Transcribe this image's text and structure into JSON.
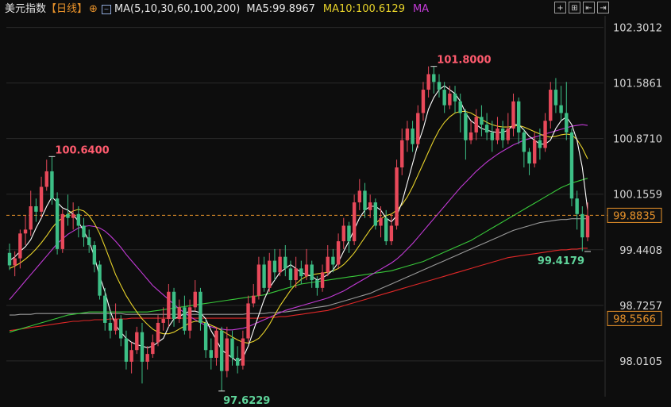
{
  "header": {
    "index_name": "美元指数",
    "period": "【日线】",
    "indicator": "MA(5,10,30,60,100,200)",
    "ma5": "MA5:99.8967",
    "ma10": "MA10:100.6129",
    "ma_more": "MA"
  },
  "toolbar": {
    "buttons": [
      "+",
      "⊞",
      "⇤",
      "⇥"
    ]
  },
  "colors": {
    "up": "#e8495a",
    "down": "#3dbf86",
    "ma5": "#ffffff",
    "ma10": "#e8d32a",
    "ma30": "#c23ad6",
    "ma60": "#38c93a",
    "ma100": "#9a9a9a",
    "ma200": "#e02828",
    "grid": "#2a2a2a",
    "dash": "#e8922a",
    "high_label": "#ff5b6e",
    "low_label": "#5fd59b"
  },
  "chart_data": {
    "type": "candlestick",
    "title": "美元指数【日线】",
    "ylim": [
      97.55,
      102.45
    ],
    "y_ticks": [
      "102.3012",
      "101.5861",
      "100.8710",
      "100.1559",
      "99.4408",
      "98.7257",
      "98.0105"
    ],
    "last_price": "99.8835",
    "last_ma200": "98.5566",
    "annotations": [
      {
        "text": "101.8000",
        "value": 101.8,
        "color": "up"
      },
      {
        "text": "100.6400",
        "value": 100.64,
        "color": "up"
      },
      {
        "text": "99.4179",
        "value": 99.4179,
        "color": "down"
      },
      {
        "text": "97.6229",
        "value": 97.6229,
        "color": "down"
      }
    ],
    "candles": [
      [
        99.4,
        99.24,
        99.52,
        99.18
      ],
      [
        99.24,
        99.33,
        99.42,
        99.1
      ],
      [
        99.33,
        99.65,
        99.7,
        99.2
      ],
      [
        99.65,
        99.7,
        99.88,
        99.5
      ],
      [
        99.7,
        100.0,
        100.2,
        99.62
      ],
      [
        100.0,
        99.93,
        100.1,
        99.8
      ],
      [
        99.93,
        100.25,
        100.38,
        99.85
      ],
      [
        100.25,
        100.45,
        100.6,
        100.2
      ],
      [
        100.45,
        100.1,
        100.64,
        100.02
      ],
      [
        100.1,
        99.45,
        100.18,
        99.38
      ],
      [
        99.45,
        99.9,
        99.96,
        99.4
      ],
      [
        99.9,
        99.85,
        100.15,
        99.75
      ],
      [
        99.85,
        99.9,
        100.05,
        99.7
      ],
      [
        99.9,
        99.75,
        100.0,
        99.6
      ],
      [
        99.75,
        99.6,
        99.85,
        99.48
      ],
      [
        99.6,
        99.5,
        99.7,
        99.4
      ],
      [
        99.5,
        99.25,
        99.55,
        99.15
      ],
      [
        99.25,
        98.85,
        99.3,
        98.8
      ],
      [
        98.85,
        98.5,
        98.95,
        98.4
      ],
      [
        98.5,
        98.4,
        98.65,
        98.3
      ],
      [
        98.4,
        98.55,
        98.75,
        98.35
      ],
      [
        98.55,
        98.3,
        98.6,
        98.2
      ],
      [
        98.3,
        98.0,
        98.4,
        97.9
      ],
      [
        98.0,
        98.15,
        98.25,
        97.85
      ],
      [
        98.15,
        98.38,
        98.45,
        98.1
      ],
      [
        98.38,
        98.0,
        98.5,
        97.72
      ],
      [
        98.0,
        98.1,
        98.2,
        97.9
      ],
      [
        98.1,
        98.25,
        98.35,
        98.05
      ],
      [
        98.25,
        98.5,
        98.6,
        98.2
      ],
      [
        98.5,
        98.55,
        98.7,
        98.4
      ],
      [
        98.55,
        98.9,
        99.0,
        98.45
      ],
      [
        98.9,
        98.55,
        98.95,
        98.45
      ],
      [
        98.55,
        98.7,
        98.8,
        98.5
      ],
      [
        98.7,
        98.4,
        98.85,
        98.35
      ],
      [
        98.4,
        98.7,
        98.8,
        98.3
      ],
      [
        98.7,
        98.9,
        99.05,
        98.65
      ],
      [
        98.9,
        98.5,
        98.95,
        98.4
      ],
      [
        98.5,
        98.15,
        98.55,
        98.05
      ],
      [
        98.15,
        98.05,
        98.3,
        97.9
      ],
      [
        98.05,
        98.4,
        98.45,
        97.95
      ],
      [
        98.4,
        97.88,
        98.45,
        97.62
      ],
      [
        97.88,
        98.3,
        98.45,
        97.8
      ],
      [
        98.3,
        98.05,
        98.4,
        97.95
      ],
      [
        98.05,
        97.95,
        98.2,
        97.85
      ],
      [
        97.95,
        98.3,
        98.4,
        97.9
      ],
      [
        98.3,
        98.75,
        98.85,
        98.25
      ],
      [
        98.75,
        98.85,
        99.0,
        98.7
      ],
      [
        98.85,
        99.25,
        99.35,
        98.8
      ],
      [
        99.25,
        98.95,
        99.35,
        98.9
      ],
      [
        98.95,
        99.3,
        99.4,
        98.9
      ],
      [
        99.3,
        99.15,
        99.45,
        99.05
      ],
      [
        99.15,
        99.35,
        99.45,
        99.1
      ],
      [
        99.35,
        99.2,
        99.5,
        99.1
      ],
      [
        99.2,
        99.05,
        99.3,
        98.95
      ],
      [
        99.05,
        99.2,
        99.35,
        98.95
      ],
      [
        99.2,
        99.1,
        99.3,
        99.0
      ],
      [
        99.1,
        99.25,
        99.45,
        99.05
      ],
      [
        99.25,
        99.05,
        99.3,
        98.95
      ],
      [
        99.05,
        98.95,
        99.1,
        98.85
      ],
      [
        98.95,
        99.15,
        99.25,
        98.9
      ],
      [
        99.15,
        99.35,
        99.5,
        99.1
      ],
      [
        99.35,
        99.25,
        99.45,
        99.15
      ],
      [
        99.25,
        99.55,
        99.65,
        99.2
      ],
      [
        99.55,
        99.75,
        99.85,
        99.45
      ],
      [
        99.75,
        99.55,
        99.8,
        99.4
      ],
      [
        99.55,
        100.05,
        100.15,
        99.5
      ],
      [
        100.05,
        100.2,
        100.35,
        99.95
      ],
      [
        100.2,
        99.95,
        100.3,
        99.85
      ],
      [
        99.95,
        100.05,
        100.15,
        99.85
      ],
      [
        100.05,
        99.75,
        100.1,
        99.7
      ],
      [
        99.75,
        99.85,
        100.0,
        99.6
      ],
      [
        99.85,
        99.55,
        99.95,
        99.5
      ],
      [
        99.55,
        99.75,
        99.9,
        99.5
      ],
      [
        99.75,
        100.5,
        100.6,
        99.7
      ],
      [
        100.5,
        100.85,
        101.0,
        100.4
      ],
      [
        100.85,
        101.0,
        101.1,
        100.7
      ],
      [
        101.0,
        100.8,
        101.1,
        100.7
      ],
      [
        100.8,
        101.2,
        101.3,
        100.75
      ],
      [
        101.2,
        101.5,
        101.6,
        101.1
      ],
      [
        101.5,
        101.7,
        101.8,
        101.4
      ],
      [
        101.7,
        101.6,
        101.8,
        101.45
      ],
      [
        101.6,
        101.5,
        101.7,
        101.4
      ],
      [
        101.5,
        101.3,
        101.6,
        101.2
      ],
      [
        101.3,
        101.45,
        101.55,
        101.25
      ],
      [
        101.45,
        101.35,
        101.55,
        101.2
      ],
      [
        101.35,
        101.2,
        101.45,
        100.95
      ],
      [
        101.2,
        100.85,
        101.25,
        100.6
      ],
      [
        100.85,
        100.95,
        101.1,
        100.8
      ],
      [
        100.95,
        101.15,
        101.25,
        100.85
      ],
      [
        101.15,
        101.05,
        101.3,
        100.9
      ],
      [
        101.05,
        100.95,
        101.2,
        100.85
      ],
      [
        100.95,
        100.85,
        101.1,
        100.7
      ],
      [
        100.85,
        101.0,
        101.15,
        100.8
      ],
      [
        101.0,
        100.85,
        101.1,
        100.75
      ],
      [
        100.85,
        101.0,
        101.2,
        100.8
      ],
      [
        101.0,
        101.35,
        101.45,
        100.9
      ],
      [
        101.35,
        100.95,
        101.4,
        100.8
      ],
      [
        100.95,
        100.7,
        101.0,
        100.5
      ],
      [
        100.7,
        100.55,
        100.75,
        100.4
      ],
      [
        100.55,
        100.85,
        100.95,
        100.5
      ],
      [
        100.85,
        100.75,
        101.0,
        100.6
      ],
      [
        100.75,
        101.1,
        101.2,
        100.7
      ],
      [
        101.1,
        101.5,
        101.6,
        101.0
      ],
      [
        101.5,
        101.3,
        101.65,
        101.2
      ],
      [
        101.3,
        101.2,
        101.55,
        101.1
      ],
      [
        101.2,
        100.95,
        101.6,
        100.85
      ],
      [
        100.95,
        100.1,
        101.0,
        100.0
      ],
      [
        100.1,
        99.9,
        100.2,
        99.7
      ],
      [
        99.9,
        99.6,
        100.0,
        99.42
      ],
      [
        99.6,
        99.88,
        100.05,
        99.55
      ]
    ],
    "ma5": [
      99.3,
      99.35,
      99.42,
      99.48,
      99.57,
      99.72,
      99.85,
      100.0,
      100.12,
      100.05,
      99.98,
      99.95,
      99.9,
      99.8,
      99.68,
      99.55,
      99.35,
      99.1,
      98.9,
      98.65,
      98.47,
      98.38,
      98.3,
      98.25,
      98.22,
      98.2,
      98.18,
      98.2,
      98.25,
      98.3,
      98.45,
      98.55,
      98.58,
      98.62,
      98.65,
      98.65,
      98.63,
      98.55,
      98.4,
      98.28,
      98.15,
      98.1,
      98.05,
      98.0,
      98.05,
      98.2,
      98.4,
      98.6,
      98.8,
      98.95,
      99.05,
      99.15,
      99.2,
      99.25,
      99.2,
      99.15,
      99.12,
      99.1,
      99.05,
      99.08,
      99.12,
      99.18,
      99.28,
      99.42,
      99.55,
      99.7,
      99.85,
      99.95,
      100.0,
      100.0,
      99.95,
      99.85,
      99.8,
      99.88,
      100.05,
      100.3,
      100.55,
      100.8,
      101.0,
      101.25,
      101.4,
      101.5,
      101.55,
      101.5,
      101.45,
      101.35,
      101.2,
      101.1,
      101.05,
      101.0,
      100.98,
      100.96,
      100.95,
      100.95,
      100.98,
      101.05,
      101.05,
      100.98,
      100.9,
      100.85,
      100.8,
      100.8,
      100.85,
      101.0,
      101.1,
      101.15,
      101.05,
      100.85,
      100.5,
      99.95
    ],
    "ma10": [
      99.2,
      99.23,
      99.27,
      99.32,
      99.38,
      99.45,
      99.53,
      99.62,
      99.72,
      99.8,
      99.85,
      99.9,
      99.94,
      99.96,
      99.94,
      99.88,
      99.78,
      99.65,
      99.48,
      99.3,
      99.12,
      98.98,
      98.85,
      98.74,
      98.64,
      98.55,
      98.48,
      98.42,
      98.38,
      98.36,
      98.36,
      98.38,
      98.42,
      98.46,
      98.5,
      98.52,
      98.52,
      98.5,
      98.47,
      98.44,
      98.4,
      98.36,
      98.32,
      98.28,
      98.25,
      98.24,
      98.26,
      98.3,
      98.38,
      98.48,
      98.6,
      98.72,
      98.82,
      98.92,
      99.0,
      99.06,
      99.1,
      99.12,
      99.13,
      99.14,
      99.15,
      99.17,
      99.2,
      99.25,
      99.32,
      99.4,
      99.5,
      99.6,
      99.7,
      99.78,
      99.84,
      99.88,
      99.9,
      99.95,
      100.02,
      100.12,
      100.25,
      100.4,
      100.55,
      100.7,
      100.85,
      100.98,
      101.08,
      101.15,
      101.2,
      101.22,
      101.22,
      101.2,
      101.16,
      101.12,
      101.08,
      101.05,
      101.03,
      101.02,
      101.02,
      101.03,
      101.04,
      101.02,
      100.99,
      100.96,
      100.93,
      100.9,
      100.89,
      100.9,
      100.92,
      100.93,
      100.92,
      100.86,
      100.75,
      100.61
    ],
    "ma30": [
      98.8,
      98.88,
      98.96,
      99.04,
      99.12,
      99.2,
      99.28,
      99.36,
      99.44,
      99.52,
      99.58,
      99.64,
      99.68,
      99.72,
      99.74,
      99.75,
      99.74,
      99.72,
      99.68,
      99.62,
      99.55,
      99.47,
      99.38,
      99.3,
      99.22,
      99.14,
      99.06,
      98.98,
      98.92,
      98.86,
      98.8,
      98.74,
      98.68,
      98.63,
      98.58,
      98.54,
      98.5,
      98.47,
      98.45,
      98.43,
      98.42,
      98.41,
      98.41,
      98.42,
      98.43,
      98.45,
      98.48,
      98.51,
      98.54,
      98.57,
      98.6,
      98.63,
      98.66,
      98.68,
      98.7,
      98.72,
      98.74,
      98.76,
      98.78,
      98.8,
      98.82,
      98.85,
      98.88,
      98.91,
      98.95,
      98.99,
      99.03,
      99.07,
      99.11,
      99.15,
      99.19,
      99.23,
      99.27,
      99.32,
      99.38,
      99.45,
      99.52,
      99.6,
      99.68,
      99.76,
      99.84,
      99.92,
      100.0,
      100.08,
      100.16,
      100.24,
      100.31,
      100.38,
      100.45,
      100.51,
      100.57,
      100.62,
      100.67,
      100.71,
      100.75,
      100.79,
      100.82,
      100.85,
      100.87,
      100.89,
      100.91,
      100.93,
      100.95,
      100.97,
      100.99,
      101.01,
      101.03,
      101.04,
      101.05,
      101.04
    ],
    "ma60": [
      98.38,
      98.4,
      98.42,
      98.44,
      98.46,
      98.48,
      98.5,
      98.52,
      98.54,
      98.56,
      98.58,
      98.6,
      98.61,
      98.62,
      98.63,
      98.64,
      98.64,
      98.64,
      98.64,
      98.64,
      98.64,
      98.64,
      98.64,
      98.64,
      98.64,
      98.64,
      98.64,
      98.65,
      98.66,
      98.67,
      98.68,
      98.69,
      98.7,
      98.71,
      98.72,
      98.73,
      98.74,
      98.75,
      98.76,
      98.77,
      98.78,
      98.79,
      98.8,
      98.81,
      98.82,
      98.83,
      98.84,
      98.85,
      98.86,
      98.88,
      98.9,
      98.92,
      98.94,
      98.96,
      98.98,
      99.0,
      99.01,
      99.02,
      99.03,
      99.04,
      99.05,
      99.06,
      99.07,
      99.08,
      99.09,
      99.1,
      99.11,
      99.12,
      99.13,
      99.14,
      99.15,
      99.16,
      99.17,
      99.19,
      99.21,
      99.23,
      99.25,
      99.27,
      99.29,
      99.32,
      99.35,
      99.38,
      99.41,
      99.44,
      99.47,
      99.5,
      99.53,
      99.56,
      99.6,
      99.64,
      99.68,
      99.72,
      99.76,
      99.8,
      99.84,
      99.88,
      99.92,
      99.96,
      100.0,
      100.04,
      100.08,
      100.12,
      100.16,
      100.2,
      100.24,
      100.27,
      100.3,
      100.32,
      100.34,
      100.36
    ],
    "ma100": [
      98.6,
      98.6,
      98.61,
      98.61,
      98.61,
      98.62,
      98.62,
      98.62,
      98.62,
      98.62,
      98.62,
      98.62,
      98.62,
      98.62,
      98.62,
      98.62,
      98.62,
      98.62,
      98.62,
      98.62,
      98.62,
      98.62,
      98.61,
      98.61,
      98.61,
      98.61,
      98.61,
      98.61,
      98.61,
      98.61,
      98.61,
      98.61,
      98.61,
      98.61,
      98.61,
      98.61,
      98.61,
      98.61,
      98.61,
      98.61,
      98.61,
      98.61,
      98.61,
      98.61,
      98.61,
      98.62,
      98.62,
      98.62,
      98.62,
      98.63,
      98.63,
      98.64,
      98.64,
      98.65,
      98.66,
      98.67,
      98.68,
      98.69,
      98.7,
      98.71,
      98.72,
      98.74,
      98.76,
      98.78,
      98.8,
      98.82,
      98.84,
      98.86,
      98.88,
      98.91,
      98.94,
      98.97,
      99.0,
      99.03,
      99.06,
      99.09,
      99.12,
      99.15,
      99.18,
      99.21,
      99.24,
      99.27,
      99.3,
      99.33,
      99.36,
      99.39,
      99.42,
      99.45,
      99.48,
      99.51,
      99.54,
      99.57,
      99.6,
      99.63,
      99.66,
      99.69,
      99.71,
      99.73,
      99.75,
      99.77,
      99.79,
      99.8,
      99.81,
      99.82,
      99.83,
      99.83,
      99.84,
      99.84,
      99.84,
      99.84
    ],
    "ma200": [
      98.4,
      98.41,
      98.42,
      98.43,
      98.44,
      98.45,
      98.46,
      98.47,
      98.48,
      98.49,
      98.5,
      98.51,
      98.52,
      98.52,
      98.53,
      98.53,
      98.54,
      98.54,
      98.54,
      98.55,
      98.55,
      98.55,
      98.55,
      98.56,
      98.56,
      98.56,
      98.56,
      98.56,
      98.56,
      98.56,
      98.56,
      98.56,
      98.56,
      98.56,
      98.56,
      98.56,
      98.56,
      98.56,
      98.56,
      98.56,
      98.56,
      98.56,
      98.56,
      98.56,
      98.56,
      98.56,
      98.56,
      98.56,
      98.57,
      98.57,
      98.57,
      98.58,
      98.58,
      98.59,
      98.6,
      98.61,
      98.62,
      98.63,
      98.64,
      98.65,
      98.66,
      98.68,
      98.7,
      98.72,
      98.74,
      98.76,
      98.78,
      98.8,
      98.82,
      98.84,
      98.86,
      98.88,
      98.9,
      98.92,
      98.94,
      98.96,
      98.98,
      99.0,
      99.02,
      99.04,
      99.06,
      99.08,
      99.1,
      99.12,
      99.14,
      99.16,
      99.18,
      99.2,
      99.22,
      99.24,
      99.26,
      99.28,
      99.3,
      99.32,
      99.34,
      99.35,
      99.36,
      99.37,
      99.38,
      99.39,
      99.4,
      99.41,
      99.42,
      99.43,
      99.44,
      99.44,
      99.45,
      99.45,
      99.46,
      99.46
    ]
  }
}
